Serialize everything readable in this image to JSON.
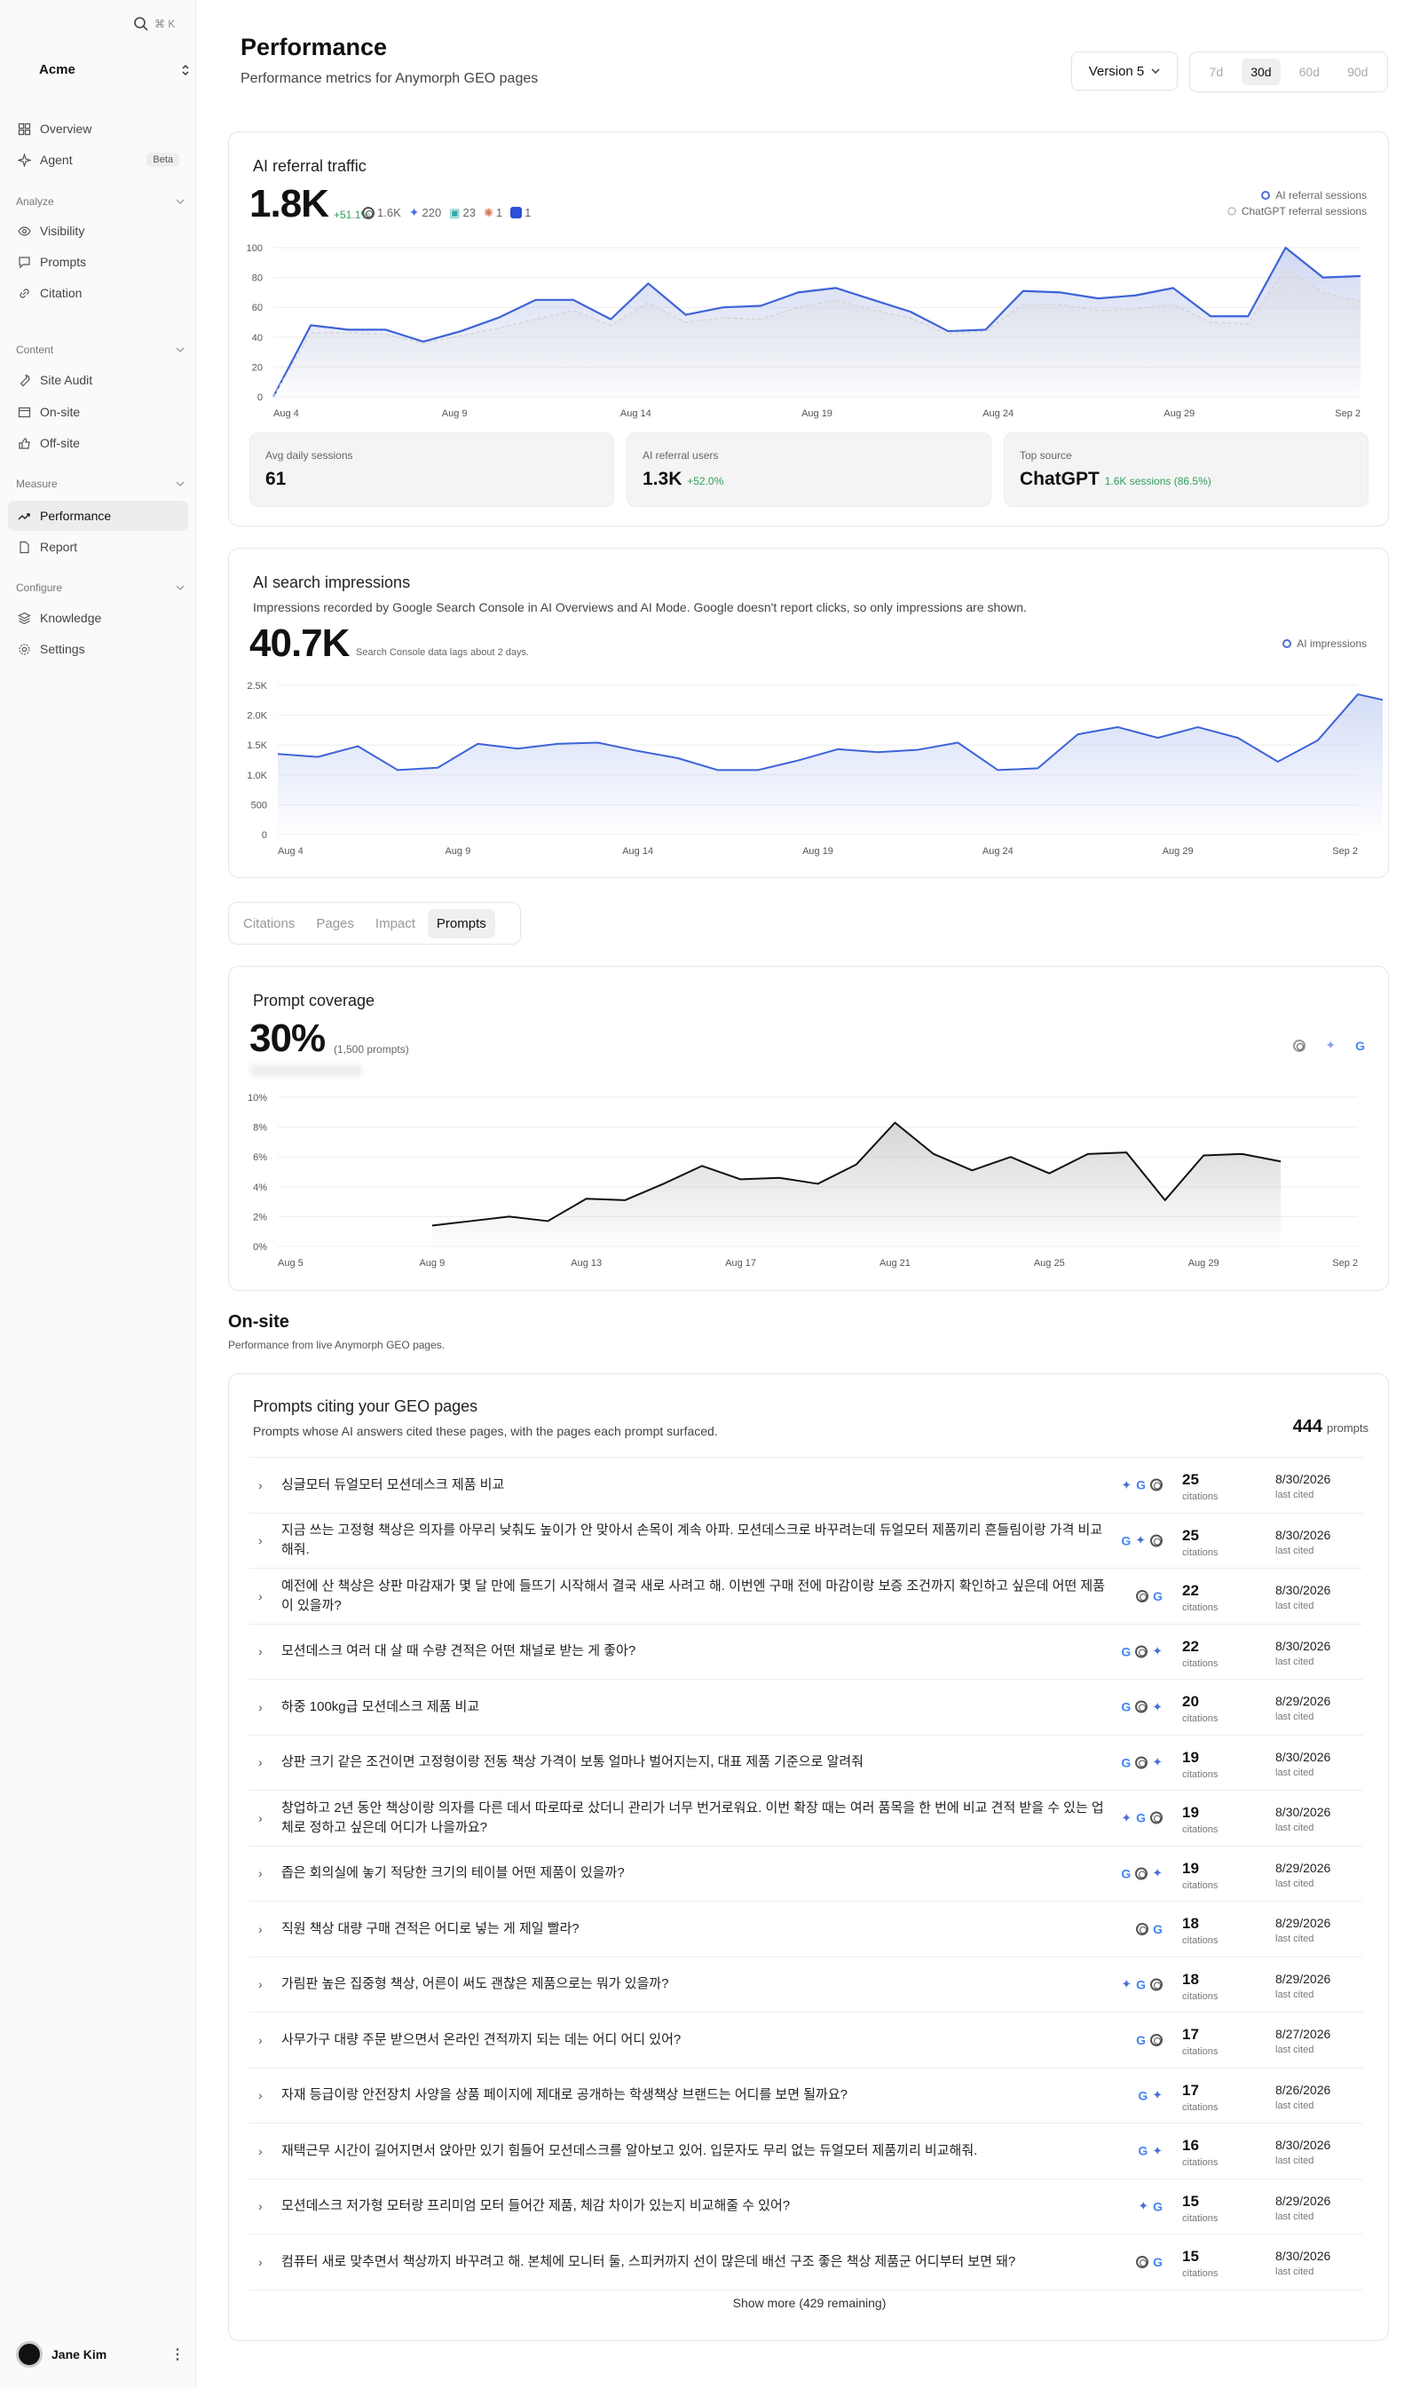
{
  "sidebar": {
    "search_shortcut": "⌘ K",
    "org": "Acme",
    "nav": [
      {
        "label": "Overview",
        "icon": "grid-icon"
      },
      {
        "label": "Agent",
        "icon": "sparkle-icon",
        "badge": "Beta"
      }
    ],
    "sections": [
      {
        "label": "Analyze",
        "items": [
          {
            "label": "Visibility",
            "icon": "eye-icon"
          },
          {
            "label": "Prompts",
            "icon": "message-icon"
          },
          {
            "label": "Citation",
            "icon": "link-icon"
          }
        ]
      },
      {
        "label": "Content",
        "items": [
          {
            "label": "Site Audit",
            "icon": "wrench-icon"
          },
          {
            "label": "On-site",
            "icon": "window-icon"
          },
          {
            "label": "Off-site",
            "icon": "thumbs-up-icon"
          }
        ]
      },
      {
        "label": "Measure",
        "items": [
          {
            "label": "Performance",
            "icon": "trend-icon"
          },
          {
            "label": "Report",
            "icon": "document-icon"
          }
        ]
      },
      {
        "label": "Configure",
        "items": [
          {
            "label": "Knowledge",
            "icon": "layers-icon"
          },
          {
            "label": "Settings",
            "icon": "gear-icon"
          }
        ]
      }
    ],
    "user": "Jane Kim"
  },
  "header": {
    "title": "Performance",
    "subtitle": "Performance metrics for Anymorph GEO pages",
    "version": "Version 5",
    "ranges": [
      "7d",
      "30d",
      "60d",
      "90d"
    ],
    "active_range": "30d"
  },
  "referral": {
    "title": "AI referral traffic",
    "total": "1.8K",
    "change": "+51.1%",
    "sources": [
      {
        "icon": "openai-icon",
        "value": "1.6K"
      },
      {
        "icon": "gemini-icon",
        "value": "220"
      },
      {
        "icon": "copilot-icon",
        "value": "23"
      },
      {
        "icon": "claude-icon",
        "value": "1"
      },
      {
        "icon": "blue-square-icon",
        "value": "1"
      }
    ],
    "legend": [
      "AI referral sessions",
      "ChatGPT referral sessions"
    ],
    "stats": [
      {
        "label": "Avg daily sessions",
        "value": "61",
        "extra": ""
      },
      {
        "label": "AI referral users",
        "value": "1.3K",
        "extra": "+52.0%"
      },
      {
        "label": "Top source",
        "value": "ChatGPT",
        "extra": "1.6K sessions (86.5%)"
      }
    ]
  },
  "impressions": {
    "title": "AI search impressions",
    "desc": "Impressions recorded by Google Search Console in AI Overviews and AI Mode. Google doesn't report clicks, so only impressions are shown.",
    "total": "40.7K",
    "note": "Search Console data lags about 2 days.",
    "legend": "AI impressions"
  },
  "tabs": [
    "Citations",
    "Pages",
    "Impact",
    "Prompts"
  ],
  "active_tab": "Prompts",
  "coverage": {
    "title": "Prompt coverage",
    "value": "30%",
    "count": "(1,500 prompts)"
  },
  "onsite": {
    "title": "On-site",
    "subtitle": "Performance from live Anymorph GEO pages.",
    "card_title": "Prompts citing your GEO pages",
    "card_desc": "Prompts whose AI answers cited these pages, with the pages each prompt surfaced.",
    "total": "444",
    "total_label": "prompts",
    "citations_label": "citations",
    "last_cited_label": "last cited",
    "rows": [
      {
        "text": "싱글모터 듀얼모터 모션데스크 제품 비교",
        "icons": [
          "gm",
          "g",
          "oa"
        ],
        "count": "25",
        "date": "8/30/2026"
      },
      {
        "text": "지금 쓰는 고정형 책상은 의자를 아무리 낮춰도 높이가 안 맞아서 손목이 계속 아파. 모션데스크로 바꾸려는데 듀얼모터 제품끼리 흔들림이랑 가격 비교해줘.",
        "icons": [
          "g",
          "gm",
          "oa"
        ],
        "count": "25",
        "date": "8/30/2026"
      },
      {
        "text": "예전에 산 책상은 상판 마감재가 몇 달 만에 들뜨기 시작해서 결국 새로 사려고 해. 이번엔 구매 전에 마감이랑 보증 조건까지 확인하고 싶은데 어떤 제품이 있을까?",
        "icons": [
          "oa",
          "g"
        ],
        "count": "22",
        "date": "8/30/2026"
      },
      {
        "text": "모션데스크 여러 대 살 때 수량 견적은 어떤 채널로 받는 게 좋아?",
        "icons": [
          "g",
          "oa",
          "gm"
        ],
        "count": "22",
        "date": "8/30/2026"
      },
      {
        "text": "하중 100kg급 모션데스크 제품 비교",
        "icons": [
          "g",
          "oa",
          "gm"
        ],
        "count": "20",
        "date": "8/29/2026"
      },
      {
        "text": "상판 크기 같은 조건이면 고정형이랑 전동 책상 가격이 보통 얼마나 벌어지는지, 대표 제품 기준으로 알려줘",
        "icons": [
          "g",
          "oa",
          "gm"
        ],
        "count": "19",
        "date": "8/30/2026"
      },
      {
        "text": "창업하고 2년 동안 책상이랑 의자를 다른 데서 따로따로 샀더니 관리가 너무 번거로워요. 이번 확장 때는 여러 품목을 한 번에 비교 견적 받을 수 있는 업체로 정하고 싶은데 어디가 나을까요?",
        "icons": [
          "gm",
          "g",
          "oa"
        ],
        "count": "19",
        "date": "8/30/2026"
      },
      {
        "text": "좁은 회의실에 놓기 적당한 크기의 테이블 어떤 제품이 있을까?",
        "icons": [
          "g",
          "oa",
          "gm"
        ],
        "count": "19",
        "date": "8/29/2026"
      },
      {
        "text": "직원 책상 대량 구매 견적은 어디로 넣는 게 제일 빨라?",
        "icons": [
          "oa",
          "g"
        ],
        "count": "18",
        "date": "8/29/2026"
      },
      {
        "text": "가림판 높은 집중형 책상, 어른이 써도 괜찮은 제품으로는 뭐가 있을까?",
        "icons": [
          "gm",
          "g",
          "oa"
        ],
        "count": "18",
        "date": "8/29/2026"
      },
      {
        "text": "사무가구 대량 주문 받으면서 온라인 견적까지 되는 데는 어디 어디 있어?",
        "icons": [
          "g",
          "oa"
        ],
        "count": "17",
        "date": "8/27/2026"
      },
      {
        "text": "자재 등급이랑 안전장치 사양을 상품 페이지에 제대로 공개하는 학생책상 브랜드는 어디를 보면 될까요?",
        "icons": [
          "g",
          "gm"
        ],
        "count": "17",
        "date": "8/26/2026"
      },
      {
        "text": "재택근무 시간이 길어지면서 앉아만 있기 힘들어 모션데스크를 알아보고 있어. 입문자도 무리 없는 듀얼모터 제품끼리 비교해줘.",
        "icons": [
          "g",
          "gm"
        ],
        "count": "16",
        "date": "8/30/2026"
      },
      {
        "text": "모션데스크 저가형 모터랑 프리미엄 모터 들어간 제품, 체감 차이가 있는지 비교해줄 수 있어?",
        "icons": [
          "gm",
          "g"
        ],
        "count": "15",
        "date": "8/29/2026"
      },
      {
        "text": "컴퓨터 새로 맞추면서 책상까지 바꾸려고 해. 본체에 모니터 둘, 스피커까지 선이 많은데 배선 구조 좋은 책상 제품군 어디부터 보면 돼?",
        "icons": [
          "oa",
          "g"
        ],
        "count": "15",
        "date": "8/30/2026"
      }
    ],
    "show_more": "Show more (429 remaining)"
  },
  "chart_data": [
    {
      "type": "area",
      "title": "AI referral traffic",
      "x": [
        "Aug 4",
        "Aug 5",
        "Aug 6",
        "Aug 7",
        "Aug 8",
        "Aug 9",
        "Aug 10",
        "Aug 11",
        "Aug 12",
        "Aug 13",
        "Aug 14",
        "Aug 15",
        "Aug 16",
        "Aug 17",
        "Aug 18",
        "Aug 19",
        "Aug 20",
        "Aug 21",
        "Aug 22",
        "Aug 23",
        "Aug 24",
        "Aug 25",
        "Aug 26",
        "Aug 27",
        "Aug 28",
        "Aug 29",
        "Aug 30",
        "Aug 31",
        "Sep 1",
        "Sep 2"
      ],
      "xticks": [
        "Aug 4",
        "Aug 9",
        "Aug 14",
        "Aug 19",
        "Aug 24",
        "Aug 29",
        "Sep 2"
      ],
      "ylim": [
        0,
        100
      ],
      "yticks": [
        0,
        20,
        40,
        60,
        80,
        100
      ],
      "series": [
        {
          "name": "AI referral sessions",
          "values": [
            0,
            48,
            45,
            45,
            37,
            44,
            53,
            65,
            65,
            52,
            76,
            55,
            60,
            61,
            70,
            73,
            65,
            57,
            44,
            45,
            71,
            70,
            66,
            68,
            73,
            54,
            54,
            100,
            80,
            81
          ]
        },
        {
          "name": "ChatGPT referral sessions",
          "values": [
            0,
            43,
            43,
            42,
            36,
            41,
            46,
            52,
            58,
            48,
            63,
            50,
            53,
            52,
            60,
            65,
            58,
            53,
            42,
            44,
            62,
            62,
            58,
            59,
            62,
            50,
            49,
            86,
            70,
            64
          ]
        }
      ],
      "grid": true,
      "legend": "top-right"
    },
    {
      "type": "area",
      "title": "AI search impressions",
      "x": [
        "Aug 4",
        "Aug 5",
        "Aug 6",
        "Aug 7",
        "Aug 8",
        "Aug 9",
        "Aug 10",
        "Aug 11",
        "Aug 12",
        "Aug 13",
        "Aug 14",
        "Aug 15",
        "Aug 16",
        "Aug 17",
        "Aug 18",
        "Aug 19",
        "Aug 20",
        "Aug 21",
        "Aug 22",
        "Aug 23",
        "Aug 24",
        "Aug 25",
        "Aug 26",
        "Aug 27",
        "Aug 28",
        "Aug 29",
        "Aug 30",
        "Aug 31"
      ],
      "xticks": [
        "Aug 4",
        "Aug 9",
        "Aug 14",
        "Aug 19",
        "Aug 24",
        "Aug 29",
        "Sep 2"
      ],
      "ylim": [
        0,
        2500
      ],
      "yticks": [
        "0",
        "500",
        "1.0K",
        "1.5K",
        "2.0K",
        "2.5K"
      ],
      "series": [
        {
          "name": "AI impressions",
          "values": [
            1350,
            1300,
            1480,
            1080,
            1120,
            1520,
            1440,
            1520,
            1540,
            1400,
            1280,
            1080,
            1080,
            1240,
            1430,
            1380,
            1420,
            1540,
            1080,
            1110,
            1680,
            1800,
            1620,
            1800,
            1620,
            1220,
            1580,
            2350,
            2200
          ]
        }
      ],
      "grid": true,
      "legend": "top-right"
    },
    {
      "type": "area",
      "title": "Prompt coverage",
      "x": [
        "Aug 5",
        "Aug 6",
        "Aug 7",
        "Aug 8",
        "Aug 9",
        "Aug 10",
        "Aug 11",
        "Aug 12",
        "Aug 13",
        "Aug 14",
        "Aug 15",
        "Aug 16",
        "Aug 17",
        "Aug 18",
        "Aug 19",
        "Aug 20",
        "Aug 21",
        "Aug 22",
        "Aug 23",
        "Aug 24",
        "Aug 25",
        "Aug 26",
        "Aug 27",
        "Aug 28",
        "Aug 29",
        "Aug 30",
        "Aug 31",
        "Sep 1",
        "Sep 2"
      ],
      "xticks": [
        "Aug 5",
        "Aug 9",
        "Aug 13",
        "Aug 17",
        "Aug 21",
        "Aug 25",
        "Aug 29",
        "Sep 2"
      ],
      "ylim": [
        0,
        10
      ],
      "yticks": [
        "0%",
        "2%",
        "4%",
        "6%",
        "8%",
        "10%"
      ],
      "series": [
        {
          "name": "",
          "values": [
            null,
            null,
            null,
            null,
            1.4,
            1.7,
            2.0,
            1.7,
            3.2,
            3.1,
            4.2,
            5.4,
            4.5,
            4.6,
            4.2,
            5.5,
            8.3,
            6.2,
            5.1,
            6.0,
            4.9,
            6.2,
            6.3,
            3.1,
            6.1,
            6.2,
            5.7,
            null,
            null
          ]
        }
      ],
      "grid": true
    }
  ]
}
